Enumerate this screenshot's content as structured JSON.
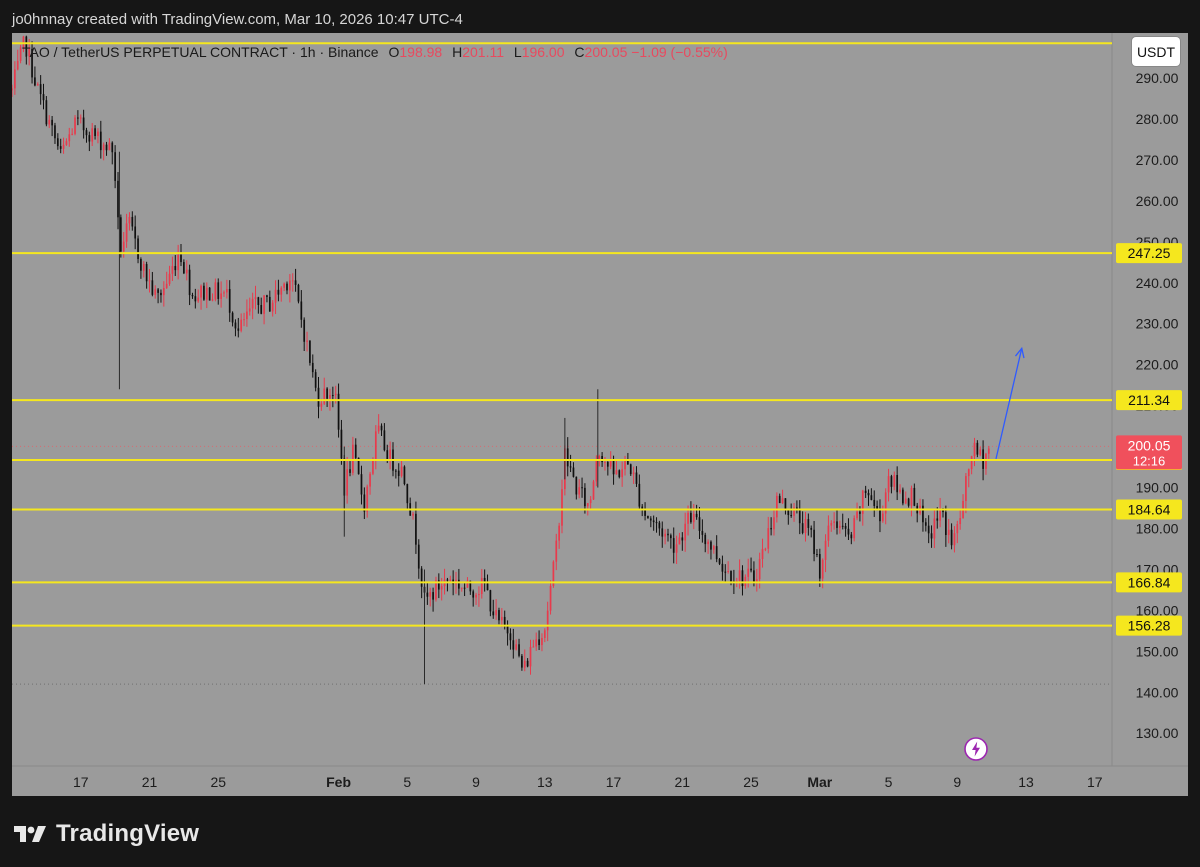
{
  "header": {
    "caption": "jo0hnnay created with TradingView.com, Mar 10, 2026 10:47 UTC-4"
  },
  "legend": {
    "symbol": "TAO / TetherUS PERPETUAL CONTRACT · 1h · Binance",
    "o_label": "O",
    "o_value": "198.98",
    "h_label": "H",
    "h_value": "201.11",
    "l_label": "L",
    "l_value": "196.00",
    "c_label": "C",
    "c_value": "200.05 −1.09 (−0.55%)"
  },
  "unit_button": "USDT",
  "brand": {
    "name": "TradingView",
    "icon": "tradingview-logo-icon"
  },
  "chart_data": {
    "type": "candlestick",
    "symbol": "TAO/USDT perpetual",
    "interval": "1h",
    "ylim": [
      122,
      301
    ],
    "y_ticks": [
      130,
      140,
      150,
      160,
      170,
      180,
      190,
      200,
      210,
      220,
      230,
      240,
      250,
      260,
      270,
      280,
      290
    ],
    "y_tick_labels": [
      "130.00",
      "140.00",
      "150.00",
      "160.00",
      "170.00",
      "180.00",
      "190.00",
      "200.00",
      "210.00",
      "220.00",
      "230.00",
      "240.00",
      "250.00",
      "260.00",
      "270.00",
      "280.00",
      "290.00"
    ],
    "x_start": "2026-01-13",
    "x_end": "2026-03-18",
    "x_ticks": [
      {
        "label": "17",
        "date": "2026-01-17",
        "bold": false
      },
      {
        "label": "21",
        "date": "2026-01-21",
        "bold": false
      },
      {
        "label": "25",
        "date": "2026-01-25",
        "bold": false
      },
      {
        "label": "Feb",
        "date": "2026-02-01",
        "bold": true
      },
      {
        "label": "5",
        "date": "2026-02-05",
        "bold": false
      },
      {
        "label": "9",
        "date": "2026-02-09",
        "bold": false
      },
      {
        "label": "13",
        "date": "2026-02-13",
        "bold": false
      },
      {
        "label": "17",
        "date": "2026-02-17",
        "bold": false
      },
      {
        "label": "21",
        "date": "2026-02-21",
        "bold": false
      },
      {
        "label": "25",
        "date": "2026-02-25",
        "bold": false
      },
      {
        "label": "Mar",
        "date": "2026-03-01",
        "bold": true
      },
      {
        "label": "5",
        "date": "2026-03-05",
        "bold": false
      },
      {
        "label": "9",
        "date": "2026-03-09",
        "bold": false
      },
      {
        "label": "13",
        "date": "2026-03-13",
        "bold": false
      },
      {
        "label": "17",
        "date": "2026-03-17",
        "bold": false
      }
    ],
    "horizontal_levels": [
      {
        "price": 298.5,
        "label": ""
      },
      {
        "price": 247.25,
        "label": "247.25"
      },
      {
        "price": 211.34,
        "label": "211.34"
      },
      {
        "price": 196.73,
        "label": "196.73"
      },
      {
        "price": 184.64,
        "label": "184.64"
      },
      {
        "price": 166.84,
        "label": "166.84"
      },
      {
        "price": 156.28,
        "label": "156.28"
      }
    ],
    "level_color": "#f5e71e",
    "current_price": {
      "price": 200.05,
      "label": "200.05",
      "countdown": "12:16",
      "color": "#f0505c"
    },
    "dotted_levels": [
      200.05,
      142
    ],
    "projection_arrow": {
      "from": {
        "date": "2026-03-11T06:00",
        "price": 197
      },
      "to": {
        "date": "2026-03-12T18:00",
        "price": 224
      },
      "color": "#2f5bff"
    },
    "candle_up_color": "#e83a4c",
    "candle_down_color": "#101010",
    "price_path": [
      {
        "date": "2026-01-13T00:00",
        "price": 287
      },
      {
        "date": "2026-01-13T18:00",
        "price": 299
      },
      {
        "date": "2026-01-14T12:00",
        "price": 287
      },
      {
        "date": "2026-01-15T06:00",
        "price": 278
      },
      {
        "date": "2026-01-15T20:00",
        "price": 271
      },
      {
        "date": "2026-01-16T16:00",
        "price": 279
      },
      {
        "date": "2026-01-17T12:00",
        "price": 277
      },
      {
        "date": "2026-01-18T08:00",
        "price": 274
      },
      {
        "date": "2026-01-18T22:00",
        "price": 272
      },
      {
        "date": "2026-01-19T06:00",
        "price": 248
      },
      {
        "date": "2026-01-19T20:00",
        "price": 254
      },
      {
        "date": "2026-01-20T16:00",
        "price": 243
      },
      {
        "date": "2026-01-21T10:00",
        "price": 236
      },
      {
        "date": "2026-01-22T00:00",
        "price": 240
      },
      {
        "date": "2026-01-22T18:00",
        "price": 248
      },
      {
        "date": "2026-01-23T12:00",
        "price": 237
      },
      {
        "date": "2026-01-24T12:00",
        "price": 238
      },
      {
        "date": "2026-01-25T12:00",
        "price": 237
      },
      {
        "date": "2026-01-26T04:00",
        "price": 228
      },
      {
        "date": "2026-01-27T00:00",
        "price": 234
      },
      {
        "date": "2026-01-28T00:00",
        "price": 235
      },
      {
        "date": "2026-01-29T06:00",
        "price": 242
      },
      {
        "date": "2026-01-30T00:00",
        "price": 228
      },
      {
        "date": "2026-01-30T18:00",
        "price": 212
      },
      {
        "date": "2026-01-31T18:00",
        "price": 214
      },
      {
        "date": "2026-02-01T08:00",
        "price": 190
      },
      {
        "date": "2026-02-01T20:00",
        "price": 198
      },
      {
        "date": "2026-02-02T12:00",
        "price": 186
      },
      {
        "date": "2026-02-03T06:00",
        "price": 204
      },
      {
        "date": "2026-02-04T00:00",
        "price": 197
      },
      {
        "date": "2026-02-04T18:00",
        "price": 194
      },
      {
        "date": "2026-02-05T12:00",
        "price": 178
      },
      {
        "date": "2026-02-06T00:00",
        "price": 162
      },
      {
        "date": "2026-02-06T20:00",
        "price": 166
      },
      {
        "date": "2026-02-07T12:00",
        "price": 168
      },
      {
        "date": "2026-02-08T12:00",
        "price": 165
      },
      {
        "date": "2026-02-09T12:00",
        "price": 166
      },
      {
        "date": "2026-02-10T06:00",
        "price": 157
      },
      {
        "date": "2026-02-11T00:00",
        "price": 155
      },
      {
        "date": "2026-02-11T18:00",
        "price": 145
      },
      {
        "date": "2026-02-12T08:00",
        "price": 152
      },
      {
        "date": "2026-02-13T00:00",
        "price": 156
      },
      {
        "date": "2026-02-13T14:00",
        "price": 172
      },
      {
        "date": "2026-02-14T04:00",
        "price": 198
      },
      {
        "date": "2026-02-14T20:00",
        "price": 190
      },
      {
        "date": "2026-02-15T14:00",
        "price": 185
      },
      {
        "date": "2026-02-16T02:00",
        "price": 200
      },
      {
        "date": "2026-02-17T00:00",
        "price": 193
      },
      {
        "date": "2026-02-17T22:00",
        "price": 196
      },
      {
        "date": "2026-02-18T18:00",
        "price": 184
      },
      {
        "date": "2026-02-19T16:00",
        "price": 180
      },
      {
        "date": "2026-02-20T14:00",
        "price": 176
      },
      {
        "date": "2026-02-21T12:00",
        "price": 183
      },
      {
        "date": "2026-02-22T12:00",
        "price": 177
      },
      {
        "date": "2026-02-23T12:00",
        "price": 170
      },
      {
        "date": "2026-02-24T12:00",
        "price": 168
      },
      {
        "date": "2026-02-25T04:00",
        "price": 168
      },
      {
        "date": "2026-02-25T18:00",
        "price": 175
      },
      {
        "date": "2026-02-26T12:00",
        "price": 187
      },
      {
        "date": "2026-02-27T12:00",
        "price": 184
      },
      {
        "date": "2026-02-28T12:00",
        "price": 178
      },
      {
        "date": "2026-03-01T00:00",
        "price": 170
      },
      {
        "date": "2026-03-01T18:00",
        "price": 183
      },
      {
        "date": "2026-03-02T18:00",
        "price": 177
      },
      {
        "date": "2026-03-03T18:00",
        "price": 190
      },
      {
        "date": "2026-03-04T12:00",
        "price": 182
      },
      {
        "date": "2026-03-05T00:00",
        "price": 193
      },
      {
        "date": "2026-03-05T18:00",
        "price": 188
      },
      {
        "date": "2026-03-06T12:00",
        "price": 188
      },
      {
        "date": "2026-03-07T06:00",
        "price": 177
      },
      {
        "date": "2026-03-08T00:00",
        "price": 184
      },
      {
        "date": "2026-03-08T18:00",
        "price": 176
      },
      {
        "date": "2026-03-09T08:00",
        "price": 186
      },
      {
        "date": "2026-03-09T20:00",
        "price": 199
      },
      {
        "date": "2026-03-10T12:00",
        "price": 197
      },
      {
        "date": "2026-03-10T22:00",
        "price": 200
      }
    ]
  }
}
